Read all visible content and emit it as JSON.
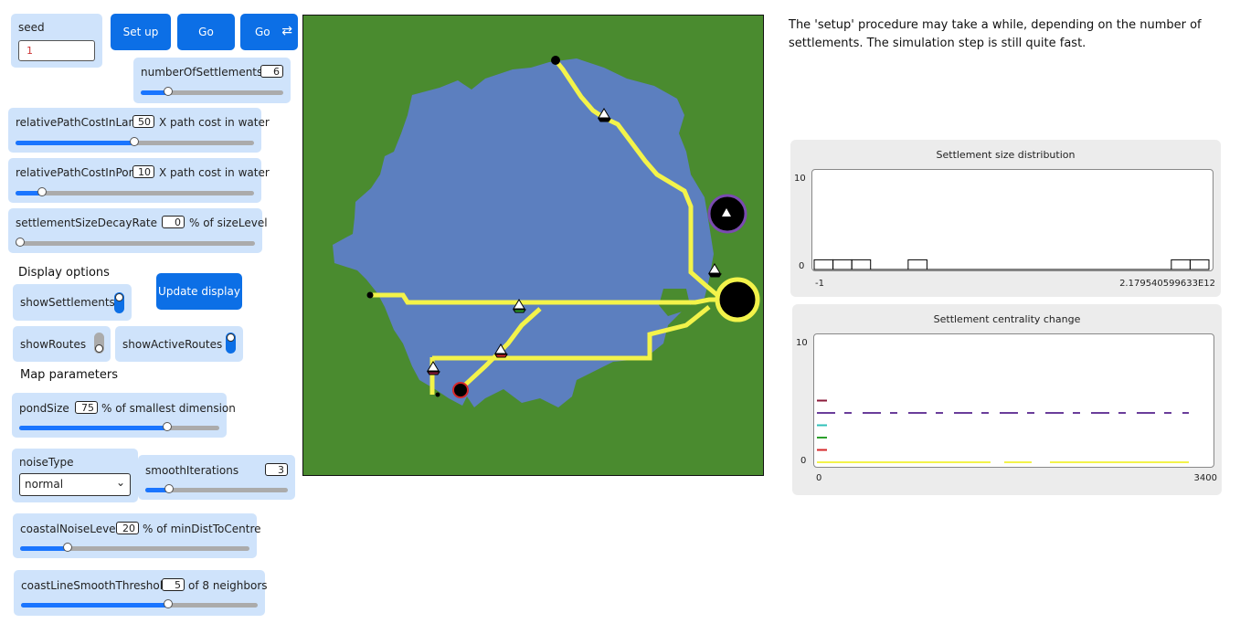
{
  "controls": {
    "seed": {
      "label": "seed",
      "value": "1"
    },
    "setup_label": "Set up",
    "go_label": "Go",
    "go_forever_label": "Go",
    "numberOfSettlements": {
      "label": "numberOfSettlements",
      "value": "6",
      "fraction": 0.1
    },
    "relativePathCostInLand": {
      "label": "relativePathCostInLand",
      "value": "50",
      "unit": "X path cost in water",
      "fraction": 0.5
    },
    "relativePathCostInPort": {
      "label": "relativePathCostInPort",
      "value": "10",
      "unit": "X path cost in water",
      "fraction": 0.1
    },
    "settlementSizeDecayRate": {
      "label": "settlementSizeDecayRate",
      "value": "0",
      "unit": "% of sizeLevel",
      "fraction": 0.0
    }
  },
  "display_options": {
    "title": "Display options",
    "showSettlements": {
      "label": "showSettlements",
      "on": true
    },
    "update_display_label": "Update display",
    "showRoutes": {
      "label": "showRoutes",
      "on": false
    },
    "showActiveRoutes": {
      "label": "showActiveRoutes",
      "on": true
    }
  },
  "map_parameters": {
    "title": "Map parameters",
    "pondSize": {
      "label": "pondSize",
      "value": "75",
      "unit": "% of smallest dimension",
      "fraction": 0.75
    },
    "noiseType": {
      "label": "noiseType",
      "selected": "normal"
    },
    "smoothIterations": {
      "label": "smoothIterations",
      "value": "3",
      "fraction": 0.15
    },
    "coastalNoiseLevel": {
      "label": "coastalNoiseLevel",
      "value": "20",
      "unit": "% of minDistToCentre",
      "fraction": 0.2
    },
    "coastLineSmoothThreshold": {
      "label": "coastLineSmoothThreshold",
      "value": "5",
      "unit": "of 8 neighbors",
      "fraction": 0.625
    }
  },
  "info_text": "The 'setup' procedure may take a while, depending on the number of settlements. The simulation step is still quite fast.",
  "colors": {
    "land": "#4a8b2f",
    "water": "#5c7fbf",
    "route": "#f3f34a",
    "accent": "#0c6fe6"
  },
  "plots": {
    "size_distribution": {
      "title": "Settlement size distribution",
      "y_max_label": "10",
      "y_min_label": "0",
      "x_min_label": "-1",
      "x_max_label": "2.179540599633E12"
    },
    "centrality_change": {
      "title": "Settlement centrality change",
      "y_max_label": "10",
      "y_min_label": "0",
      "x_min_label": "0",
      "x_max_label": "3400"
    }
  },
  "chart_data": [
    {
      "type": "bar",
      "title": "Settlement size distribution",
      "xlim": [
        -1,
        2179540599633
      ],
      "ylim": [
        0,
        10
      ],
      "bins_counts": [
        1,
        1,
        1,
        0,
        0,
        1,
        0,
        0,
        0,
        0,
        0,
        0,
        0,
        0,
        0,
        0,
        0,
        0,
        0,
        1,
        1
      ]
    },
    {
      "type": "line",
      "title": "Settlement centrality change",
      "xlim": [
        0,
        3400
      ],
      "ylim": [
        0,
        10
      ],
      "series": [
        {
          "color": "#6a3d9a",
          "level": 4
        },
        {
          "color": "#8b1a3a",
          "level": 5
        },
        {
          "color": "#30c0b8",
          "level": 3
        },
        {
          "color": "#2ca02c",
          "level": 2
        },
        {
          "color": "#d62728",
          "level": 1
        },
        {
          "color": "#f3f34a",
          "level": 0
        }
      ]
    }
  ]
}
